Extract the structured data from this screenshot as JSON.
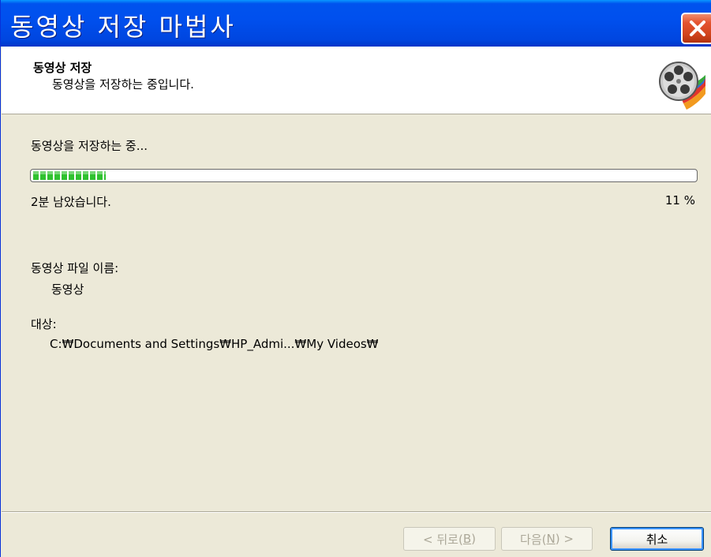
{
  "window": {
    "title": "동영상 저장 마법사"
  },
  "header": {
    "title": "동영상 저장",
    "subtitle": "동영상을 저장하는 중입니다.",
    "icon": "film-reel-icon"
  },
  "progress": {
    "status": "동영상을 저장하는 중...",
    "fraction": 0.11,
    "time_remaining": "2분 남았습니다.",
    "percent_text": "11 %"
  },
  "file": {
    "name_label": "동영상 파일 이름:",
    "name_value": "동영상",
    "dest_label": "대상:",
    "dest_value": "C:₩Documents and Settings₩HP_Admi...₩My Videos₩"
  },
  "buttons": {
    "back": {
      "text": "< 뒤로(",
      "key": "B",
      "end": ")"
    },
    "next": {
      "text": "다음(",
      "key": "N",
      "end": ") >"
    },
    "cancel": "취소"
  },
  "colors": {
    "titlebar": "#0053ee",
    "progress_fill": "#2fc22f",
    "close_button": "#d2441d"
  }
}
